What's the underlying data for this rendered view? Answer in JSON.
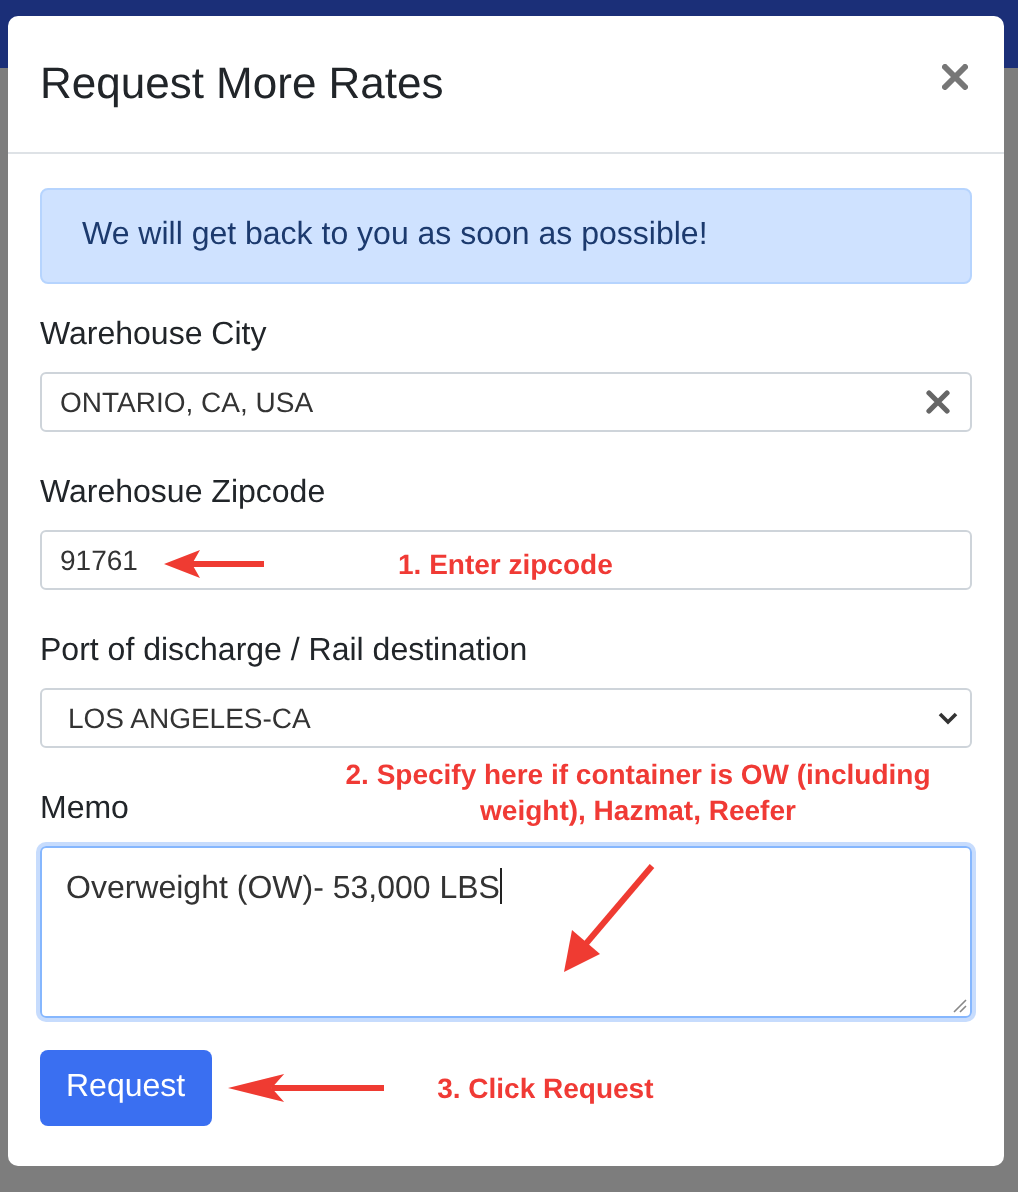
{
  "modal": {
    "title": "Request More Rates",
    "alert": "We will get back to you as soon as possible!",
    "fields": [
      {
        "kind": "clearable",
        "label": "Warehouse City",
        "value": "ONTARIO, CA, USA"
      },
      {
        "kind": "text",
        "label": "Warehosue Zipcode",
        "value": "91761",
        "annotation": {
          "kind": "left",
          "text": "1. Enter zipcode"
        }
      },
      {
        "kind": "select",
        "label": "Port of discharge / Rail destination",
        "value": "LOS ANGELES-CA"
      },
      {
        "kind": "textarea",
        "label": "Memo",
        "value": "Overweight (OW)- 53,000 LBS",
        "focused": true,
        "annotation": {
          "kind": "down-left",
          "text": "2. Specify here if container is OW (including weight), Hazmat, Reefer"
        }
      }
    ],
    "button": {
      "label": "Request",
      "annotation": {
        "kind": "left",
        "text": "3. Click Request"
      }
    }
  }
}
